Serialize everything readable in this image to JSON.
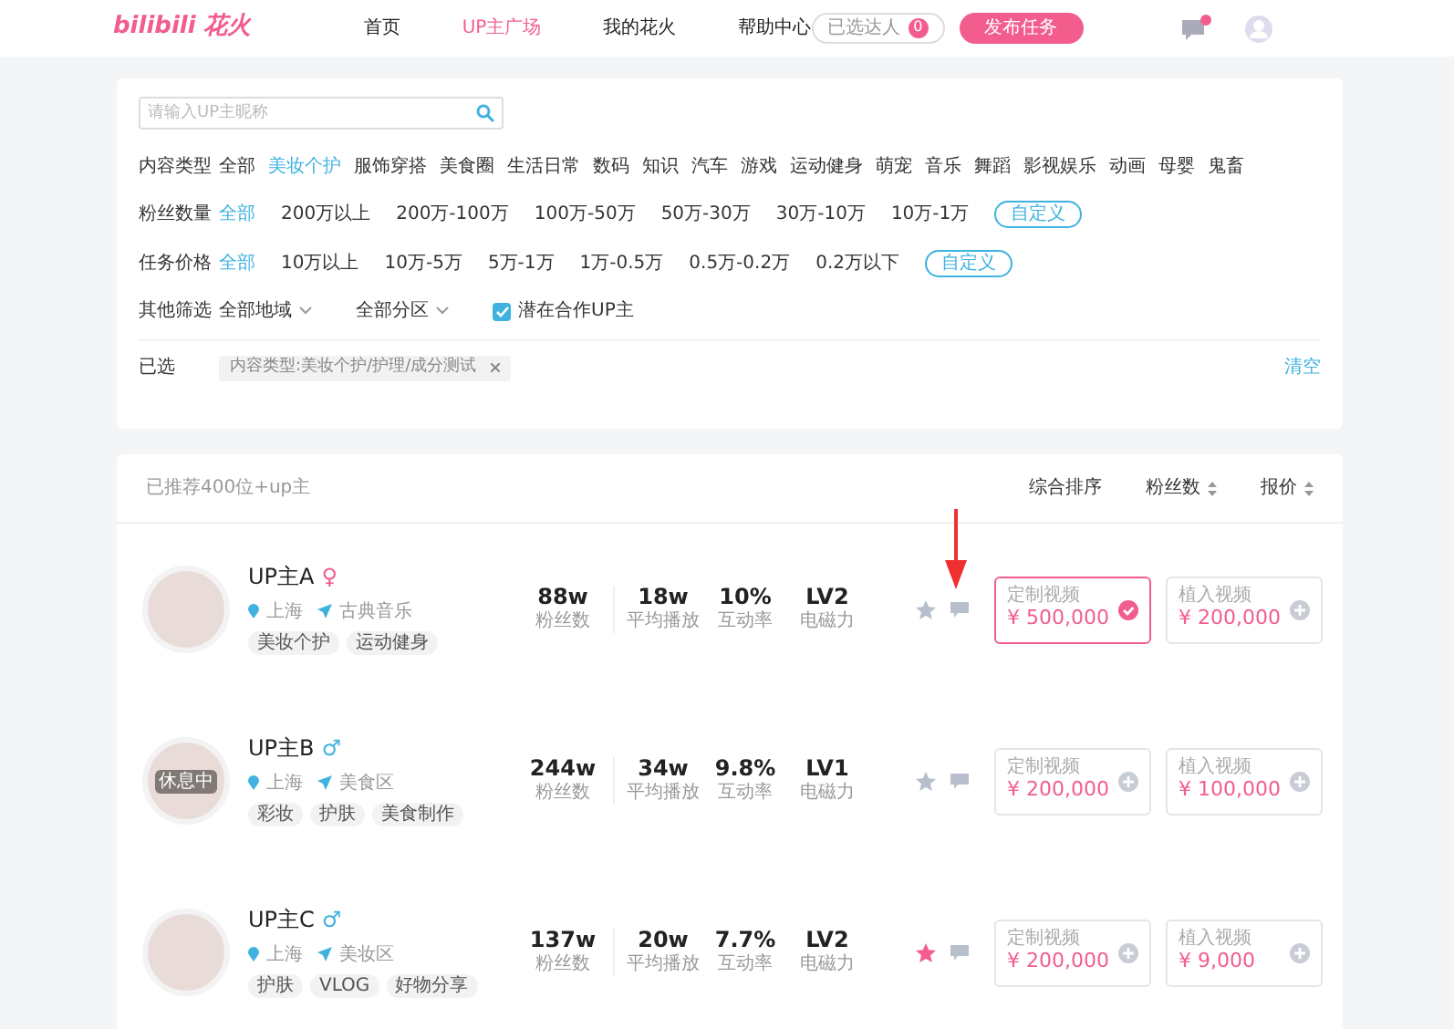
{
  "header": {
    "logo": "bilibili",
    "logo_suffix": "花火",
    "nav": [
      {
        "label": "首页",
        "selected": false
      },
      {
        "label": "UP主广场",
        "selected": true
      },
      {
        "label": "我的花火",
        "selected": false
      },
      {
        "label": "帮助中心",
        "selected": false
      }
    ],
    "selected_creators": {
      "label": "已选达人",
      "count": "0"
    },
    "publish_button": "发布任务"
  },
  "filters": {
    "search": {
      "placeholder": "请输入UP主昵称"
    },
    "groups": [
      {
        "label": "内容类型",
        "options": [
          {
            "label": "全部",
            "selected": false
          },
          {
            "label": "美妆个护",
            "selected": true
          },
          {
            "label": "服饰穿搭",
            "selected": false
          },
          {
            "label": "美食圈",
            "selected": false
          },
          {
            "label": "生活日常",
            "selected": false
          },
          {
            "label": "数码",
            "selected": false
          },
          {
            "label": "知识",
            "selected": false
          },
          {
            "label": "汽车",
            "selected": false
          },
          {
            "label": "游戏",
            "selected": false
          },
          {
            "label": "运动健身",
            "selected": false
          },
          {
            "label": "萌宠",
            "selected": false
          },
          {
            "label": "音乐",
            "selected": false
          },
          {
            "label": "舞蹈",
            "selected": false
          },
          {
            "label": "影视娱乐",
            "selected": false
          },
          {
            "label": "动画",
            "selected": false
          },
          {
            "label": "母婴",
            "selected": false
          },
          {
            "label": "鬼畜",
            "selected": false
          }
        ]
      },
      {
        "label": "粉丝数量",
        "custom": "自定义",
        "options": [
          {
            "label": "全部",
            "selected": true
          },
          {
            "label": "200万以上",
            "selected": false
          },
          {
            "label": "200万-100万",
            "selected": false
          },
          {
            "label": "100万-50万",
            "selected": false
          },
          {
            "label": "50万-30万",
            "selected": false
          },
          {
            "label": "30万-10万",
            "selected": false
          },
          {
            "label": "10万-1万",
            "selected": false
          }
        ]
      },
      {
        "label": "任务价格",
        "custom": "自定义",
        "options": [
          {
            "label": "全部",
            "selected": true
          },
          {
            "label": "10万以上",
            "selected": false
          },
          {
            "label": "10万-5万",
            "selected": false
          },
          {
            "label": "5万-1万",
            "selected": false
          },
          {
            "label": "1万-0.5万",
            "selected": false
          },
          {
            "label": "0.5万-0.2万",
            "selected": false
          },
          {
            "label": "0.2万以下",
            "selected": false
          }
        ]
      }
    ],
    "other": {
      "label": "其他筛选",
      "dropdowns": [
        "全部地域",
        "全部分区"
      ],
      "checkbox": {
        "label": "潜在合作UP主",
        "checked": true
      }
    },
    "chosen": {
      "label": "已选",
      "chips": [
        "内容类型:美妆个护/护理/成分测试"
      ],
      "clear": "清空"
    }
  },
  "results": {
    "count_text": "已推荐400位+up主",
    "sorts": [
      {
        "label": "综合排序",
        "sortable": false
      },
      {
        "label": "粉丝数",
        "sortable": true
      },
      {
        "label": "报价",
        "sortable": true
      }
    ],
    "creators": [
      {
        "name": "UP主A",
        "gender": {
          "symbol": "♀",
          "color": "#f25d8e"
        },
        "location": "上海",
        "category": "古典音乐",
        "tags": [
          "美妆个护",
          "运动健身"
        ],
        "stats": [
          {
            "value": "88w",
            "label": "粉丝数"
          },
          {
            "value": "18w",
            "label": "平均播放"
          },
          {
            "value": "10%",
            "label": "互动率"
          },
          {
            "value": "LV2",
            "label": "电磁力"
          }
        ],
        "starred": false,
        "arrow_marker": true,
        "prices": [
          {
            "label": "定制视频",
            "amount": "¥ 500,000",
            "selected": true
          },
          {
            "label": "植入视频",
            "amount": "¥ 200,000",
            "selected": false
          }
        ]
      },
      {
        "name": "UP主B",
        "gender": {
          "symbol": "♂",
          "color": "#3fb2e0"
        },
        "avatar_status": "休息中",
        "location": "上海",
        "category": "美食区",
        "tags": [
          "彩妆",
          "护肤",
          "美食制作"
        ],
        "stats": [
          {
            "value": "244w",
            "label": "粉丝数"
          },
          {
            "value": "34w",
            "label": "平均播放"
          },
          {
            "value": "9.8%",
            "label": "互动率"
          },
          {
            "value": "LV1",
            "label": "电磁力"
          }
        ],
        "starred": false,
        "arrow_marker": false,
        "prices": [
          {
            "label": "定制视频",
            "amount": "¥ 200,000",
            "selected": false
          },
          {
            "label": "植入视频",
            "amount": "¥ 100,000",
            "selected": false
          }
        ]
      },
      {
        "name": "UP主C",
        "gender": {
          "symbol": "♂",
          "color": "#3fb2e0"
        },
        "location": "上海",
        "category": "美妆区",
        "tags": [
          "护肤",
          "VLOG",
          "好物分享"
        ],
        "stats": [
          {
            "value": "137w",
            "label": "粉丝数"
          },
          {
            "value": "20w",
            "label": "平均播放"
          },
          {
            "value": "7.7%",
            "label": "互动率"
          },
          {
            "value": "LV2",
            "label": "电磁力"
          }
        ],
        "starred": true,
        "arrow_marker": false,
        "prices": [
          {
            "label": "定制视频",
            "amount": "¥ 200,000",
            "selected": false
          },
          {
            "label": "植入视频",
            "amount": "¥ 9,000",
            "selected": false
          }
        ]
      }
    ]
  }
}
